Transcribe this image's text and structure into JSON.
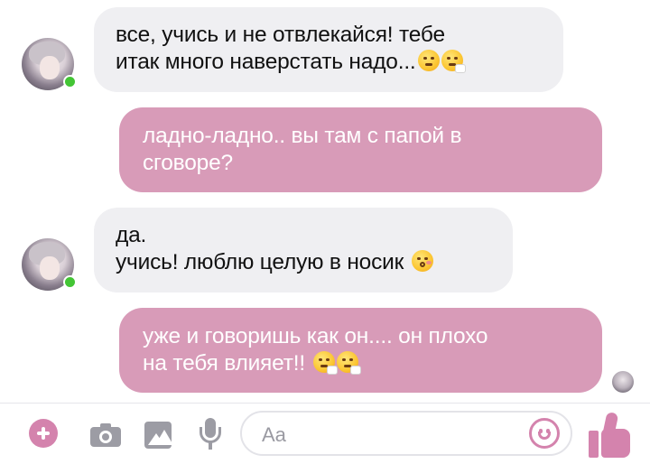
{
  "conversation": {
    "messages": [
      {
        "direction": "incoming",
        "lines": [
          "все, учись и не отвлекайся! тебе",
          "итак много наверстать надо..."
        ],
        "emoji": [
          "steam-from-nose-emoji",
          "sneezing-face-emoji"
        ]
      },
      {
        "direction": "outgoing",
        "lines": [
          "ладно-ладно.. вы там с папой в",
          "сговоре?"
        ],
        "emoji": []
      },
      {
        "direction": "incoming",
        "lines": [
          "да.",
          "учись! люблю целую в носик"
        ],
        "emoji": [
          "kissing-face-emoji"
        ]
      },
      {
        "direction": "outgoing",
        "lines": [
          "уже и говоришь как он.... он плохо",
          "на тебя влияет!!"
        ],
        "emoji": [
          "sneezing-face-emoji",
          "sneezing-face-emoji"
        ]
      }
    ],
    "contact_status": "online"
  },
  "composer": {
    "placeholder": "Aa",
    "icons": [
      "plus-icon",
      "camera-icon",
      "image-icon",
      "microphone-icon",
      "emoji-icon",
      "thumbs-up-icon"
    ]
  },
  "colors": {
    "outgoing_bubble": "#d89bb8",
    "incoming_bubble": "#efeff2",
    "accent": "#d483ad",
    "online": "#43c535",
    "toolbar_icon": "#9c9ca4"
  }
}
